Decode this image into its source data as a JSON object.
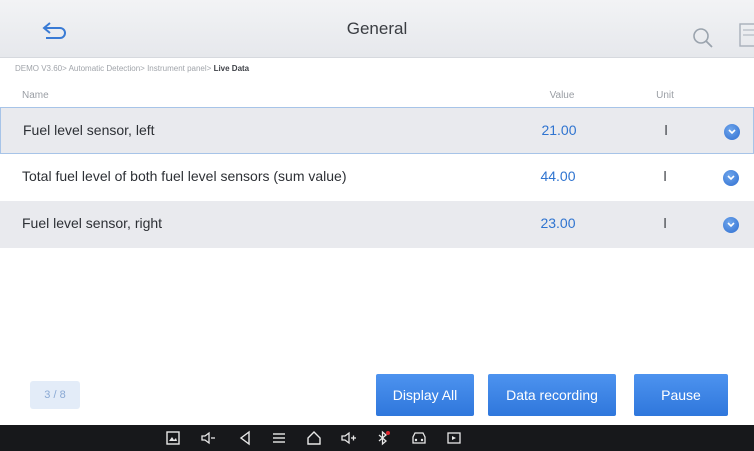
{
  "header": {
    "title": "General"
  },
  "breadcrumb": {
    "path": "DEMO V3.60> Automatic Detection> Instrument panel> ",
    "current": "Live Data"
  },
  "columns": {
    "name": "Name",
    "value": "Value",
    "unit": "Unit"
  },
  "rows": [
    {
      "name": "Fuel level sensor, left",
      "value": "21.00",
      "unit": "l"
    },
    {
      "name": "Total fuel level of both fuel level sensors (sum value)",
      "value": "44.00",
      "unit": "l"
    },
    {
      "name": "Fuel level sensor, right",
      "value": "23.00",
      "unit": "l"
    }
  ],
  "footer": {
    "page_indicator": "3 / 8",
    "display_all": "Display All",
    "data_recording": "Data recording",
    "pause": "Pause"
  },
  "icons": {
    "back": "back-arrow-icon",
    "search": "search-icon",
    "row_action": "expand-circle-icon",
    "nav": [
      "gallery-icon",
      "volume-down-icon",
      "back-triangle-icon",
      "menu-icon",
      "home-icon",
      "volume-up-icon",
      "bluetooth-icon",
      "vehicle-diagnostics-icon",
      "screen-record-icon"
    ]
  },
  "colors": {
    "accent": "#2f77dc",
    "value_text": "#2f74d0",
    "row_highlight": "#e9eaee",
    "nav_background": "#17181b"
  }
}
